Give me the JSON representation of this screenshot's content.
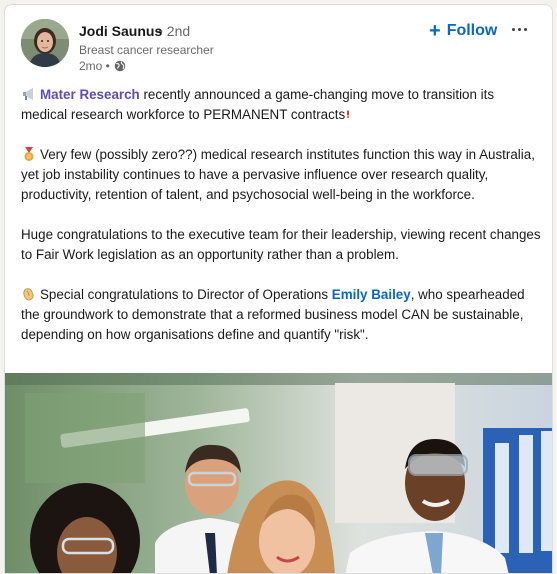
{
  "author": {
    "name": "Jodi Saunus",
    "degree": "• 2nd",
    "headline": "Breast cancer researcher",
    "time": "2mo •",
    "visibility_icon": "globe-icon"
  },
  "actions": {
    "follow_label": "Follow",
    "follow_icon": "plus-icon",
    "more_icon": "more-icon"
  },
  "post": {
    "p1_mention": "Mater Research",
    "p1_text": " recently announced a game-changing move to transition its medical research workforce to PERMANENT contracts",
    "p2_text": "Very few (possibly zero??) medical research institutes function this way in Australia, yet job instability continues to have a pervasive influence over research quality, productivity, retention of talent, and psychosocial well-being in the workforce.",
    "p3_text": "Huge congratulations to the executive team for their leadership, viewing recent changes to Fair Work legislation as an opportunity rather than a problem.",
    "p4_text_a": "Special congratulations to Director of Operations ",
    "p4_mention": "Emily Bailey",
    "p4_text_b": ", who spearheaded the groundwork to demonstrate that a reformed business model CAN be sustainable, depending on how organisations define and quantify \"risk\"."
  },
  "colors": {
    "follow": "#0a66c2",
    "company_mention": "#5f4bb6",
    "person_mention": "#0a66c2"
  }
}
